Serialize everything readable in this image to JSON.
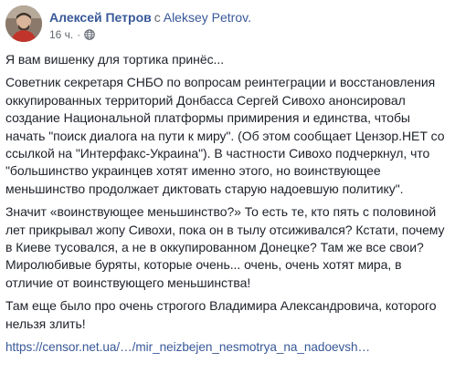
{
  "post": {
    "author": "Алексей Петров",
    "separator": "с",
    "with_user": "Aleksey Petrov.",
    "time": "16 ч.",
    "dot": "·",
    "privacy_icon": "globe-icon",
    "paragraphs": [
      "Я вам вишенку для тортика принёс...",
      "Советник секретаря СНБО по вопросам реинтеграции и восстановления оккупированных территорий Донбасса Сергей Сивохо анонсировал создание Национальной платформы примирения и единства, чтобы начать \"поиск диалога на пути к миру\". (Об этом сообщает Цензор.НЕТ со ссылкой на \"Интерфакс-Украина\"). В частности Сивохо подчеркнул, что \"большинство украинцев хотят именно этого, но воинствующее меньшинство продолжает диктовать старую надоевшую политику\".",
      "Значит «воинствующее меньшинство?» То есть те, кто пять с половиной лет прикрывал жопу Сивохи, пока он в тылу отсиживался? Кстати, почему в Киеве тусовался, а не в оккупированном Донецке? Там же все свои? Миролюбивые буряты, которые очень... очень, очень хотят мира, в отличие от воинствующего меньшинства!",
      "Там еще было про очень строгого Владимира Александровича, которого нельзя злить!"
    ],
    "link": "https://censor.net.ua/…/mir_neizbejen_nesmotrya_na_nadoevsh…"
  },
  "colors": {
    "link": "#385898",
    "text": "#1d2129",
    "meta": "#616770"
  }
}
